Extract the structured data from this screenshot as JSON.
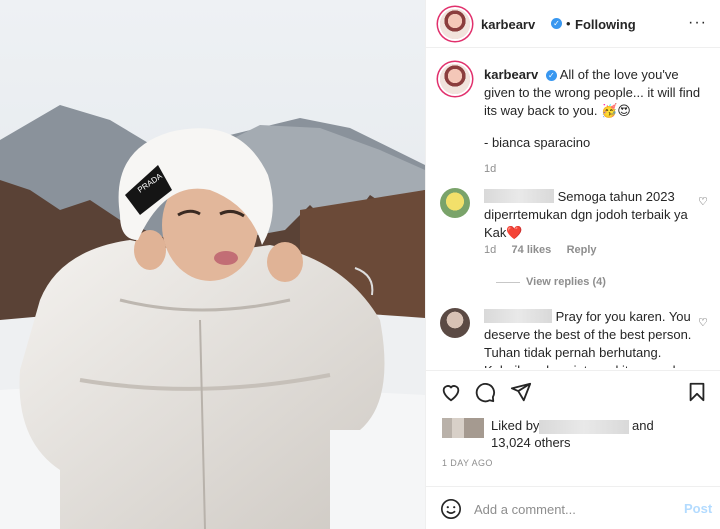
{
  "header": {
    "username": "karbearv",
    "separator": "•",
    "following_label": "Following",
    "more": "···"
  },
  "caption": {
    "username": "karbearv",
    "text": "All of the love you've given to the wrong people... it will find its way back to you. 🥳😍",
    "quote": "- bianca sparacino",
    "time": "1d"
  },
  "comments": [
    {
      "text_line1": "Semoga tahun 2023",
      "text_rest": "diperrtemukan dgn jodoh terbaik ya Kak❤️",
      "time": "1d",
      "likes": "74 likes",
      "reply": "Reply",
      "view_replies": "View replies (4)"
    },
    {
      "text_line1": "Pray for you karen. You",
      "text_rest": "deserve the best of the best person. Tuhan tidak pernah berhutang. Kebaikan dan cinta yg kita pernah",
      "time": "",
      "likes": "",
      "reply": ""
    }
  ],
  "likes": {
    "label": "Liked by",
    "and": "and",
    "count": "13,024 others"
  },
  "post_date": "1 DAY AGO",
  "add_comment": {
    "placeholder": "Add a comment...",
    "post_label": "Post"
  },
  "colors": {
    "verified": "#3897f0",
    "post_button": "#b3dbff",
    "muted_text": "#8e8e8e"
  },
  "icons": [
    "heart-icon",
    "comment-icon",
    "share-icon",
    "bookmark-icon",
    "emoji-icon",
    "verified-icon",
    "more-icon"
  ]
}
